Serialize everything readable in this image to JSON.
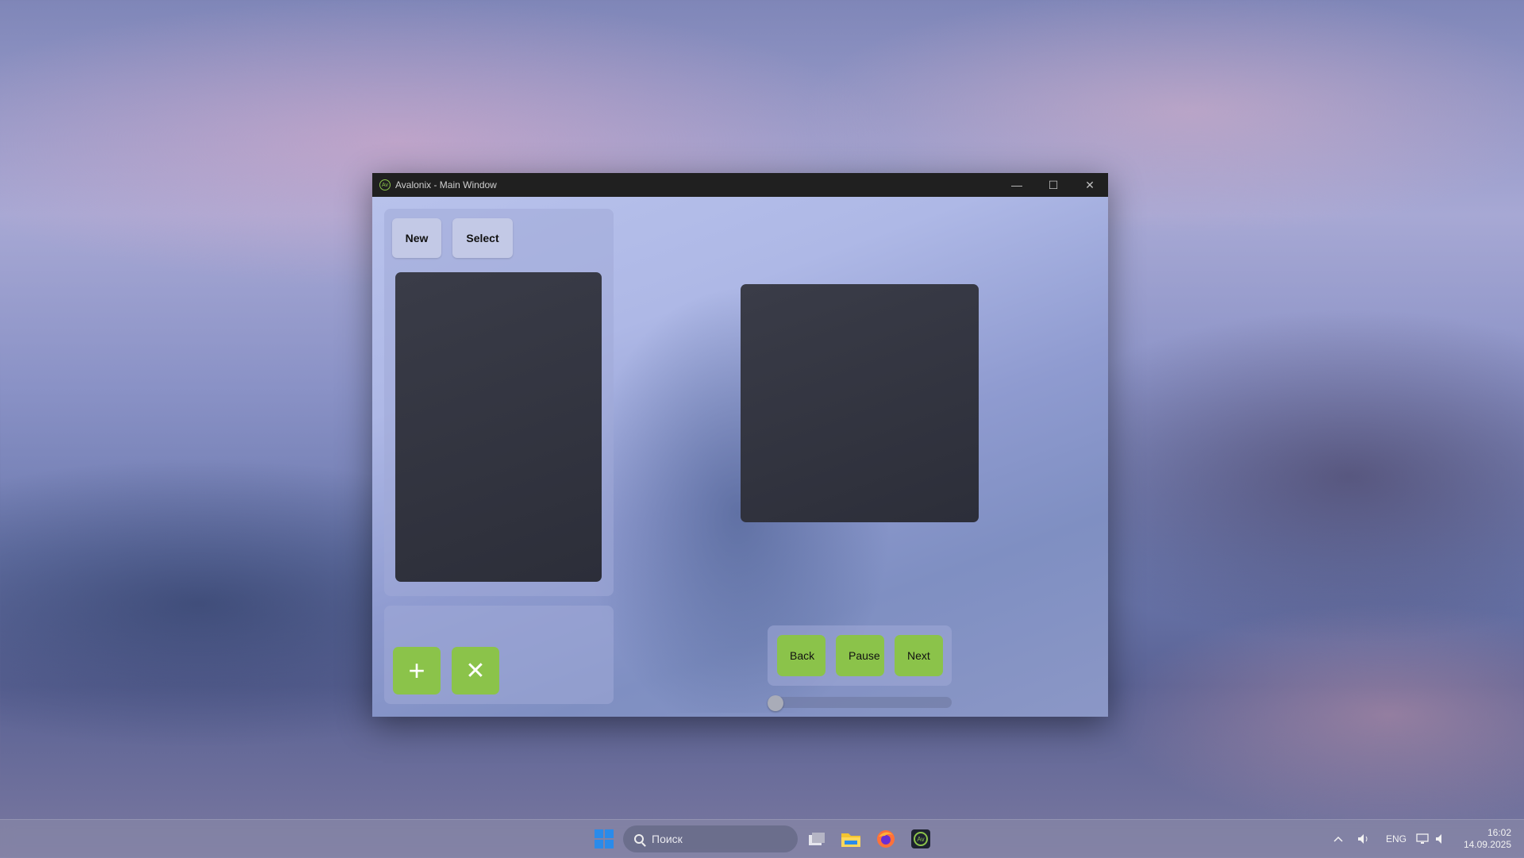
{
  "window": {
    "title": "Avalonix - Main Window",
    "icon_label": "Av",
    "controls": {
      "minimize": "—",
      "maximize": "☐",
      "close": "✕"
    }
  },
  "toolbar": {
    "new_label": "New",
    "select_label": "Select"
  },
  "actions": {
    "add_label": "+",
    "remove_label": "✕"
  },
  "player": {
    "back_label": "Back",
    "pause_label": "Pause",
    "next_label": "Next",
    "progress_fraction": 0.0
  },
  "taskbar": {
    "search_placeholder": "Поиск",
    "language": "ENG",
    "time": "16:02",
    "date": "14.09.2025"
  },
  "colors": {
    "accent": "#8bc34a",
    "titlebar": "#202020"
  }
}
